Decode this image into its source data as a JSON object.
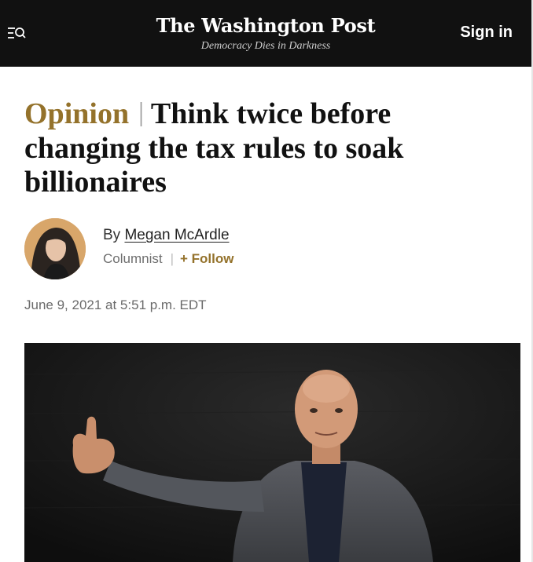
{
  "header": {
    "menu_icon": "menu-search-icon",
    "logo": "The Washington Post",
    "tagline": "Democracy Dies in Darkness",
    "signin_label": "Sign in"
  },
  "article": {
    "kicker": "Opinion",
    "divider": "|",
    "title": "Think twice before changing the tax rules to soak billionaires",
    "byline_prefix": "By",
    "author": "Megan McArdle",
    "role": "Columnist",
    "role_divider": "|",
    "follow_label": "+ Follow",
    "date": "June 9, 2021 at 5:51 p.m. EDT"
  },
  "colors": {
    "accent": "#94722b",
    "header_bg": "#111111"
  }
}
